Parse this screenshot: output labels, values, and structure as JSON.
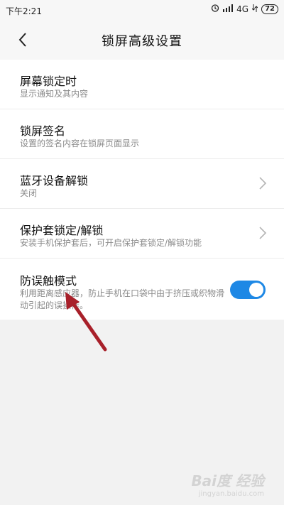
{
  "status": {
    "time": "下午2:21",
    "network": "4G",
    "battery": "72",
    "icons": [
      "alarm-icon",
      "signal-icon",
      "network-icon",
      "battery-icon"
    ]
  },
  "header": {
    "title": "锁屏高级设置",
    "back_icon": "chevron-left-icon"
  },
  "settings": [
    {
      "title": "屏幕锁定时",
      "subtitle": "显示通知及其内容"
    },
    {
      "title": "锁屏签名",
      "subtitle": "设置的签名内容在锁屏页面显示"
    },
    {
      "title": "蓝牙设备解锁",
      "subtitle": "关闭",
      "icon": "chevron-right-icon"
    },
    {
      "title": "保护套锁定/解锁",
      "subtitle": "安装手机保护套后，可开启保护套锁定/解锁功能",
      "icon": "chevron-right-icon"
    },
    {
      "title": "防误触模式",
      "subtitle": "利用距离感应器，防止手机在口袋中由于挤压或织物滑动引起的误操作。",
      "toggle_on": true
    }
  ],
  "colors": {
    "accent": "#1e88e5",
    "annotation": "#a8202a"
  },
  "watermark": {
    "brand": "Bai度 经验",
    "sub": "jingyan.baidu.com"
  }
}
